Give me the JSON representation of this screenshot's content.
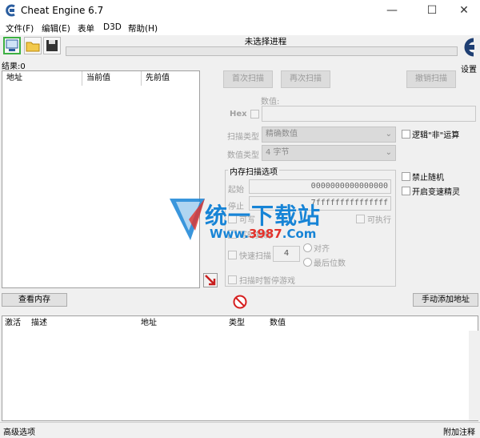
{
  "window": {
    "title": "Cheat Engine 6.7"
  },
  "menu": [
    "文件(F)",
    "编辑(E)",
    "表单",
    "D3D",
    "帮助(H)"
  ],
  "toolbar": {
    "process_label": "未选择进程",
    "settings_label": "设置"
  },
  "results": {
    "label": "结果:0",
    "columns": [
      "地址",
      "当前值",
      "先前值"
    ]
  },
  "scan": {
    "first_scan": "首次扫描",
    "next_scan": "再次扫描",
    "undo_scan": "撤销扫描",
    "value_label": "数值:",
    "hex_label": "Hex",
    "scan_type_label": "扫描类型",
    "scan_type_value": "精确数值",
    "value_type_label": "数值类型",
    "value_type_value": "4 字节",
    "logic_not": "逻辑\"非\"运算",
    "mem_options_title": "内存扫描选项",
    "start_label": "起始",
    "start_value": "0000000000000000",
    "stop_label": "停止",
    "stop_value": "7fffffffffffffff",
    "writable": "可写",
    "executable": "可执行",
    "copy_on_write": "写时复制",
    "fast_scan": "快速扫描",
    "fast_scan_value": "4",
    "align": "对齐",
    "last_digits": "最后位数",
    "pause_game": "扫描时暂停游戏",
    "disable_random": "禁止随机",
    "speedhack": "开启变速精灵"
  },
  "watermark": {
    "text": "统一下载站",
    "url_a": "Www.",
    "url_b": "3987",
    "url_c": ".Com"
  },
  "buttons": {
    "view_memory": "查看内存",
    "add_address": "手动添加地址"
  },
  "address_list": {
    "columns": [
      "激活",
      "描述",
      "地址",
      "类型",
      "数值"
    ]
  },
  "status": {
    "advanced": "高级选项",
    "comments": "附加注释"
  }
}
